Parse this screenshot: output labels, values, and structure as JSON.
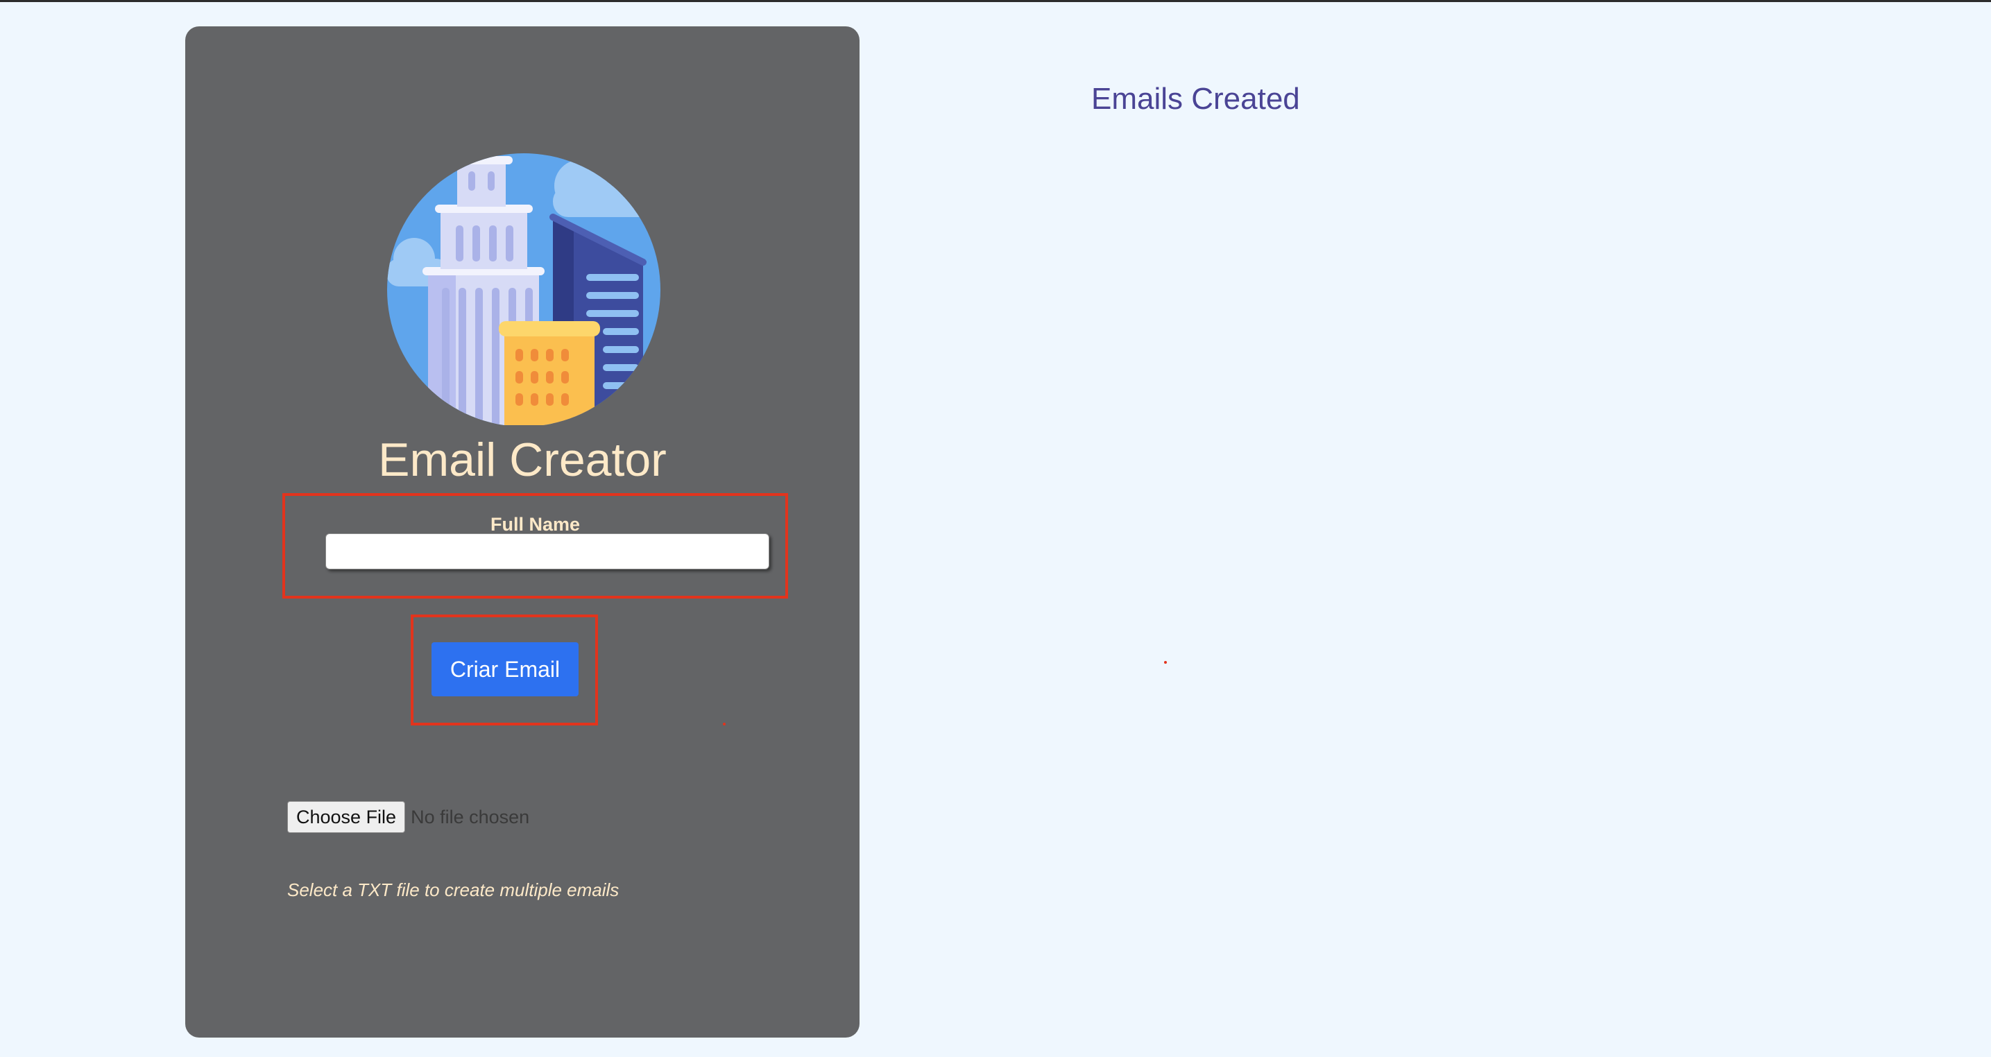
{
  "app": {
    "title": "Email Creator"
  },
  "form": {
    "full_name_label": "Full Name",
    "full_name_value": "",
    "create_button_label": "Criar Email"
  },
  "file_upload": {
    "choose_button_label": "Choose File",
    "status_text": "No file chosen",
    "hint_text": "Select a TXT file to create multiple emails"
  },
  "results": {
    "heading": "Emails Created",
    "items": []
  },
  "icons": {
    "logo": "city-buildings-icon"
  },
  "colors": {
    "page_background": "#eff7fe",
    "card_background": "#636466",
    "title_text": "#fde9c8",
    "primary_button": "#2d71f0",
    "highlight_border": "#e2341d",
    "results_heading": "#4a4495"
  }
}
